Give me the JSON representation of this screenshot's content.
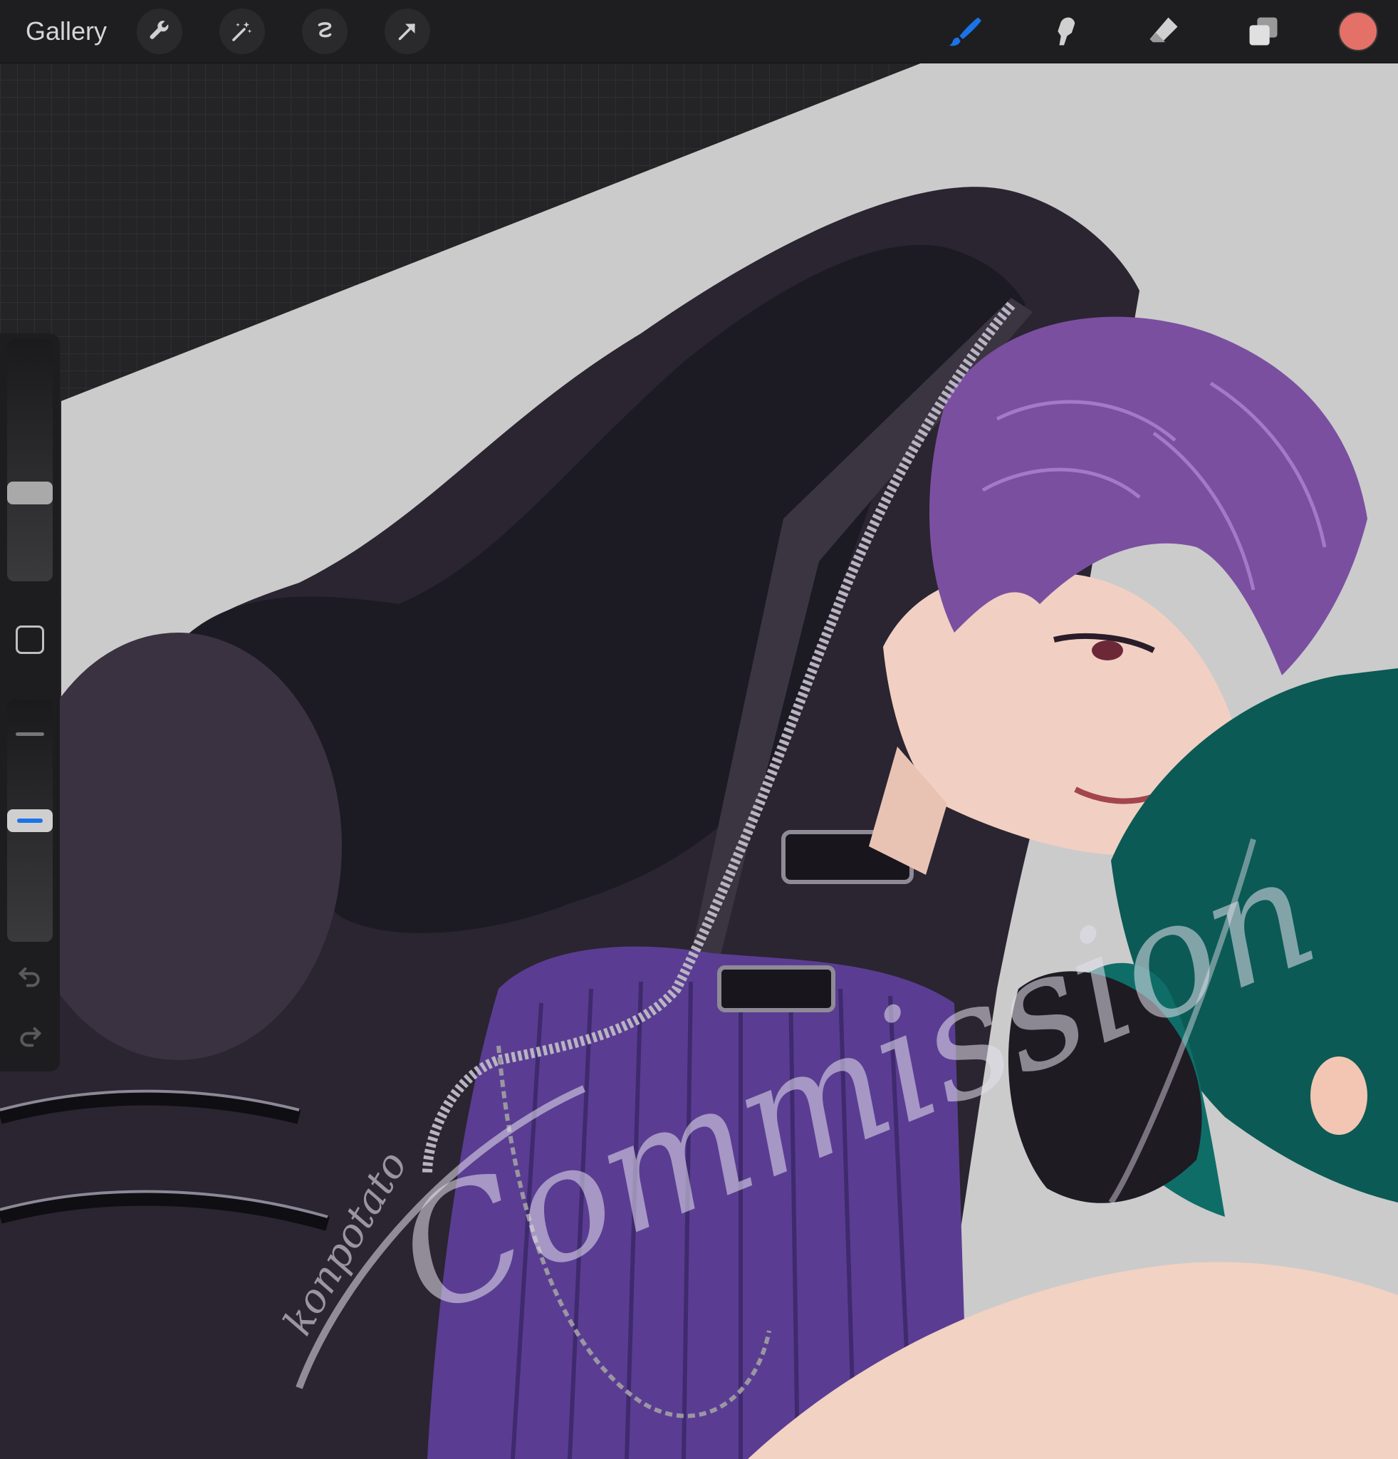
{
  "toolbar": {
    "gallery_label": "Gallery",
    "left_tools": [
      "wrench-icon",
      "magic-wand-icon",
      "selection-icon",
      "transform-arrow-icon"
    ],
    "right_tools": [
      "brush-icon",
      "smudge-icon",
      "eraser-icon",
      "layers-icon"
    ],
    "active_tool": "brush-icon",
    "brush_color": "#1a73e8",
    "current_color": "#e47168"
  },
  "sidebar": {
    "brush_size_level": 0.35,
    "opacity_level": 0.5,
    "controls": [
      "brush-size-slider",
      "modify-button",
      "opacity-slider",
      "undo-icon",
      "redo-icon"
    ]
  },
  "artwork": {
    "watermark": "Commission",
    "signature": "konpotato"
  }
}
